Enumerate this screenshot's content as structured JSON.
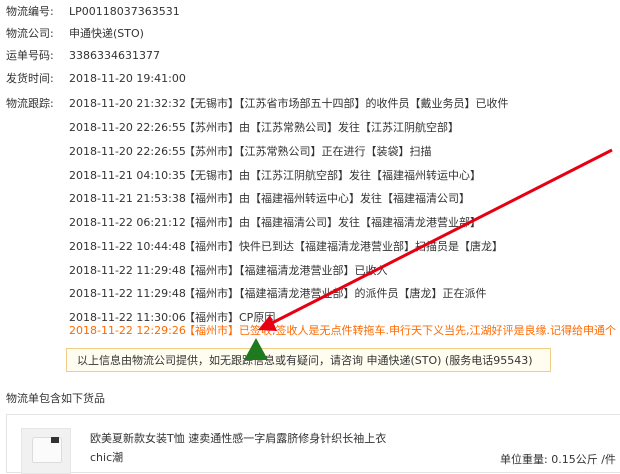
{
  "info": {
    "tracking_no_label": "物流编号:",
    "tracking_no": "LP00118037363531",
    "company_label": "物流公司:",
    "company": "申通快递(STO)",
    "waybill_label": "运单号码:",
    "waybill": "3386334631377",
    "ship_time_label": "发货时间:",
    "ship_time": "2018-11-20 19:41:00"
  },
  "tracking": {
    "label": "物流跟踪:",
    "events": [
      {
        "time": "2018-11-20 21:32:32",
        "text": "【无锡市】【江苏省市场部五十四部】的收件员【戴业务员】已收件"
      },
      {
        "time": "2018-11-20 22:26:55",
        "text": "【苏州市】由【江苏常熟公司】发往【江苏江阴航空部】"
      },
      {
        "time": "2018-11-20 22:26:55",
        "text": "【苏州市】【江苏常熟公司】正在进行【装袋】扫描"
      },
      {
        "time": "2018-11-21 04:10:35",
        "text": "【无锡市】由【江苏江阴航空部】发往【福建福州转运中心】"
      },
      {
        "time": "2018-11-21 21:53:38",
        "text": "【福州市】由【福建福州转运中心】发往【福建福清公司】"
      },
      {
        "time": "2018-11-22 06:21:12",
        "text": "【福州市】由【福建福清公司】发往【福建福清龙港营业部】"
      },
      {
        "time": "2018-11-22 10:44:48",
        "text": "【福州市】快件已到达【福建福清龙港营业部】扫描员是【唐龙】"
      },
      {
        "time": "2018-11-22 11:29:48",
        "text": "【福州市】【福建福清龙港营业部】已收入"
      },
      {
        "time": "2018-11-22 11:29:48",
        "text": "【福州市】【福建福清龙港营业部】的派件员【唐龙】正在派件"
      },
      {
        "time": "2018-11-22 11:30:06",
        "text": "【福州市】CP原因"
      },
      {
        "time": "2018-11-22 12:29:26",
        "text": "【福州市】已签收,签收人是无点件转拖车.申行天下义当先,江湖好评是良缘.记得给申通个"
      }
    ]
  },
  "notice": "以上信息由物流公司提供，如无跟踪信息或有疑问，请咨询 申通快递(STO) (服务电话95543)",
  "goods": {
    "section_title": "物流单包含如下货品",
    "title": "欧美夏新款女装T恤 速卖通性感一字肩露脐修身针织长袖上衣",
    "shop": "chic潮",
    "weight_label": "单位重量:",
    "weight": "0.15公斤 /件"
  },
  "colors": {
    "annotation_arrow": "#e60012",
    "annotation_marker": "#1f7a1f",
    "latest_event": "#ff6a00"
  }
}
